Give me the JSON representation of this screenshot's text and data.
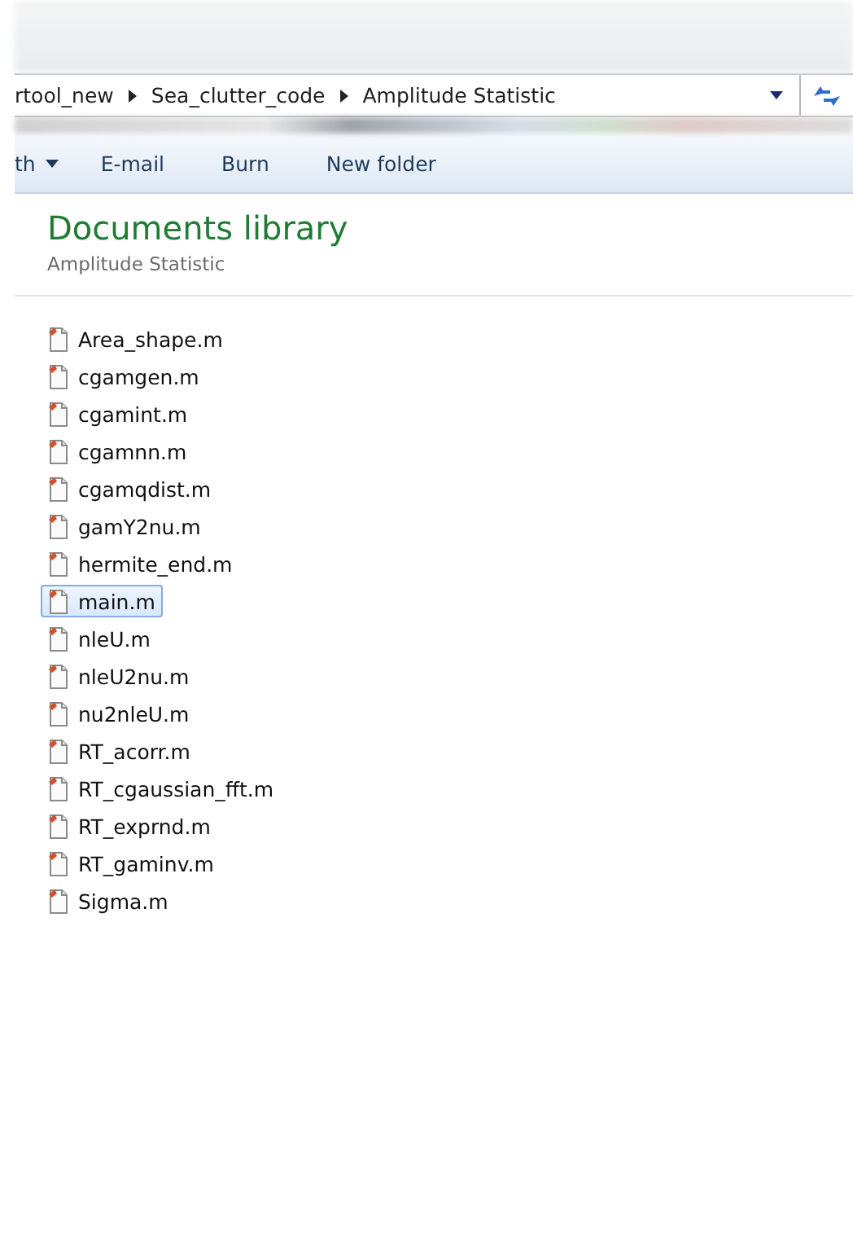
{
  "address_bar": {
    "crumbs": [
      "rtool_new",
      "Sea_clutter_code",
      "Amplitude Statistic"
    ]
  },
  "toolbar": {
    "items": [
      {
        "label": "th",
        "dropdown": true
      },
      {
        "label": "E-mail",
        "dropdown": false
      },
      {
        "label": "Burn",
        "dropdown": false
      },
      {
        "label": "New folder",
        "dropdown": false
      }
    ]
  },
  "library": {
    "title": "Documents library",
    "subtitle": "Amplitude Statistic"
  },
  "files": [
    {
      "name": "Area_shape.m",
      "selected": false
    },
    {
      "name": "cgamgen.m",
      "selected": false
    },
    {
      "name": "cgamint.m",
      "selected": false
    },
    {
      "name": "cgamnn.m",
      "selected": false
    },
    {
      "name": "cgamqdist.m",
      "selected": false
    },
    {
      "name": "gamY2nu.m",
      "selected": false
    },
    {
      "name": "hermite_end.m",
      "selected": false
    },
    {
      "name": "main.m",
      "selected": true
    },
    {
      "name": "nleU.m",
      "selected": false
    },
    {
      "name": "nleU2nu.m",
      "selected": false
    },
    {
      "name": "nu2nleU.m",
      "selected": false
    },
    {
      "name": "RT_acorr.m",
      "selected": false
    },
    {
      "name": "RT_cgaussian_fft.m",
      "selected": false
    },
    {
      "name": "RT_exprnd.m",
      "selected": false
    },
    {
      "name": "RT_gaminv.m",
      "selected": false
    },
    {
      "name": "Sigma.m",
      "selected": false
    }
  ]
}
